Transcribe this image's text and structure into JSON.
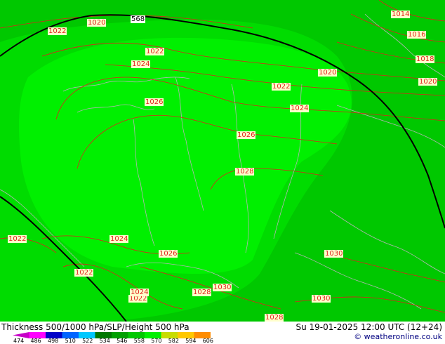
{
  "map": {
    "isobar_labels": [
      {
        "text": "1014",
        "key": "l1014a"
      },
      {
        "text": "1016",
        "key": "l1016a"
      },
      {
        "text": "1018",
        "key": "l1018a"
      },
      {
        "text": "1020",
        "key": "l1020a"
      },
      {
        "text": "1020",
        "key": "l1020b"
      },
      {
        "text": "1020",
        "key": "l1020c"
      },
      {
        "text": "1022",
        "key": "l1022a"
      },
      {
        "text": "1022",
        "key": "l1022b"
      },
      {
        "text": "1022",
        "key": "l1022c"
      },
      {
        "text": "1022",
        "key": "l1022d"
      },
      {
        "text": "1022",
        "key": "l1022e"
      },
      {
        "text": "1022",
        "key": "l1022f"
      },
      {
        "text": "1024",
        "key": "l1024a"
      },
      {
        "text": "1024",
        "key": "l1024b"
      },
      {
        "text": "1024",
        "key": "l1024c"
      },
      {
        "text": "1024",
        "key": "l1024d"
      },
      {
        "text": "1026",
        "key": "l1026a"
      },
      {
        "text": "1026",
        "key": "l1026b"
      },
      {
        "text": "1026",
        "key": "l1026c"
      },
      {
        "text": "1028",
        "key": "l1028a"
      },
      {
        "text": "1028",
        "key": "l1028b"
      },
      {
        "text": "1028",
        "key": "l1028c"
      },
      {
        "text": "1030",
        "key": "l1030a"
      },
      {
        "text": "1030",
        "key": "l1030b"
      },
      {
        "text": "1030",
        "key": "l1030c"
      }
    ],
    "height_label": "568",
    "colors": {
      "outer_green": "#00c800",
      "mid_green": "#00dc00",
      "inner_green": "#00f000",
      "isobar": "#e0201b",
      "height_contour": "#000000",
      "border": "#b4b4b4"
    }
  },
  "footer": {
    "title": "Thickness 500/1000 hPa/SLP/Height 500 hPa",
    "datetime": "Su 19-01-2025 12:00 UTC (12+24)",
    "credit": "© weatheronline.co.uk",
    "legend_ticks": [
      "474",
      "486",
      "498",
      "510",
      "522",
      "534",
      "546",
      "558",
      "570",
      "582",
      "594",
      "606"
    ],
    "legend_colors": [
      "#c800c8",
      "#ff00ff",
      "#0000c8",
      "#0064ff",
      "#00c8ff",
      "#007800",
      "#00a000",
      "#00c800",
      "#00f000",
      "#c8dc00",
      "#ffc800",
      "#ff8c00"
    ]
  }
}
